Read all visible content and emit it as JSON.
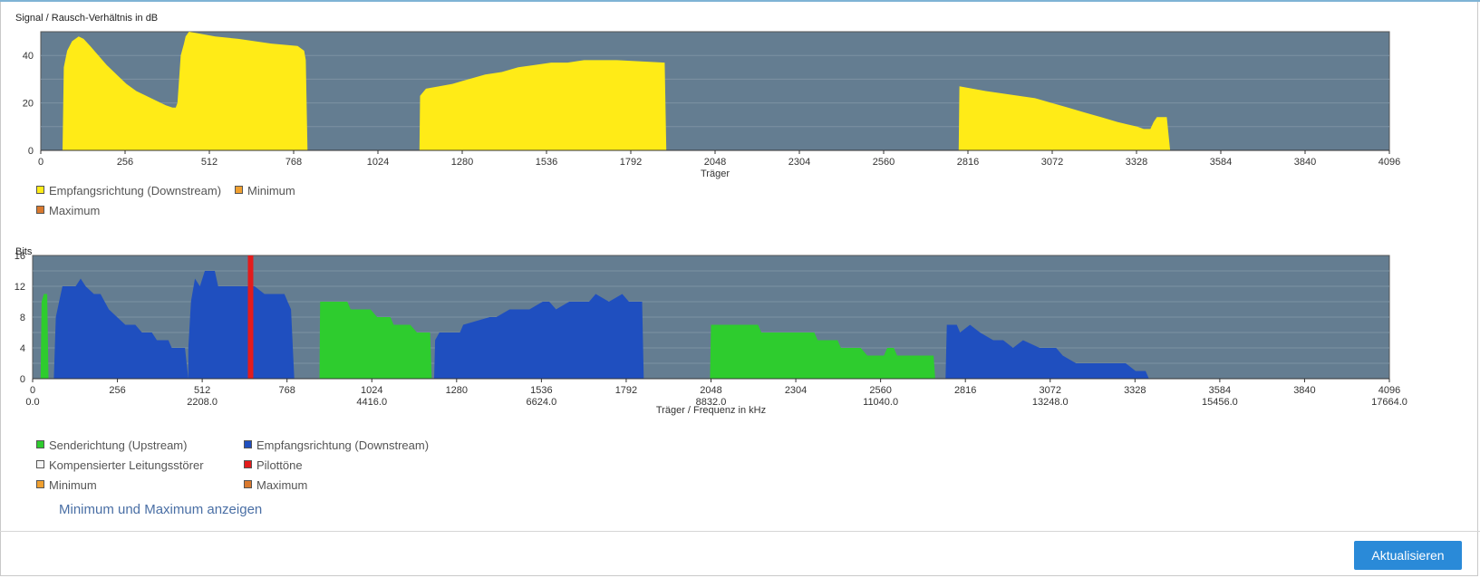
{
  "colors": {
    "plot_bg": "#647d91",
    "grid": "#7d92a3",
    "downstream_snr": "#ffeb17",
    "upstream": "#2ecc2e",
    "downstream_bits": "#1f4fbf",
    "pilot": "#e31c1c",
    "minimum": "#f0a030",
    "maximum": "#d9792e",
    "button": "#2a8ad8"
  },
  "charts": {
    "snr": {
      "title": "Signal / Rausch-Verhältnis in dB",
      "xlabel": "Träger",
      "legend": [
        {
          "label": "Empfangsrichtung (Downstream)",
          "color": "#ffeb17"
        },
        {
          "label": "Minimum",
          "color": "#f0a030"
        },
        {
          "label": "Maximum",
          "color": "#d9792e"
        }
      ]
    },
    "bits": {
      "title": "Bits",
      "xlabel": "Träger / Frequenz in kHz",
      "legend": [
        {
          "label": "Senderichtung (Upstream)",
          "color": "#2ecc2e"
        },
        {
          "label": "Empfangsrichtung (Downstream)",
          "color": "#1f4fbf"
        },
        {
          "label": "Kompensierter Leitungsstörer",
          "color": "#f5f5f5"
        },
        {
          "label": "Pilottöne",
          "color": "#e31c1c"
        },
        {
          "label": "Minimum",
          "color": "#f0a030"
        },
        {
          "label": "Maximum",
          "color": "#d9792e"
        }
      ]
    }
  },
  "chart_data": [
    {
      "type": "area",
      "title": "Signal / Rausch-Verhältnis in dB",
      "xlabel": "Träger",
      "ylabel": "",
      "xlim": [
        0,
        4096
      ],
      "ylim": [
        0,
        50
      ],
      "xticks": [
        0,
        256,
        512,
        768,
        1024,
        1280,
        1536,
        1792,
        2048,
        2304,
        2560,
        2816,
        3072,
        3328,
        3584,
        3840,
        4096
      ],
      "yticks": [
        0,
        20,
        40
      ],
      "grid": true,
      "legend_position": "bottom",
      "series": [
        {
          "name": "Empfangsrichtung (Downstream)",
          "color": "#ffeb17",
          "segments": [
            [
              [
                66,
                0
              ],
              [
                70,
                35
              ],
              [
                80,
                42
              ],
              [
                95,
                46
              ],
              [
                115,
                48
              ],
              [
                130,
                47
              ],
              [
                150,
                44
              ],
              [
                175,
                40
              ],
              [
                200,
                36
              ],
              [
                230,
                32
              ],
              [
                260,
                28
              ],
              [
                290,
                25
              ],
              [
                320,
                23
              ],
              [
                350,
                21
              ],
              [
                380,
                19
              ],
              [
                400,
                18
              ],
              [
                410,
                18
              ],
              [
                415,
                20
              ],
              [
                425,
                40
              ],
              [
                435,
                45
              ],
              [
                440,
                48
              ],
              [
                450,
                50
              ],
              [
                530,
                48
              ],
              [
                600,
                47
              ],
              [
                700,
                45
              ],
              [
                780,
                44
              ],
              [
                800,
                42
              ],
              [
                805,
                38
              ],
              [
                810,
                0
              ]
            ],
            [
              [
                1150,
                0
              ],
              [
                1152,
                23
              ],
              [
                1170,
                26
              ],
              [
                1210,
                27
              ],
              [
                1250,
                28
              ],
              [
                1300,
                30
              ],
              [
                1350,
                32
              ],
              [
                1400,
                33
              ],
              [
                1450,
                35
              ],
              [
                1500,
                36
              ],
              [
                1550,
                37
              ],
              [
                1600,
                37
              ],
              [
                1650,
                38
              ],
              [
                1700,
                38
              ],
              [
                1750,
                38
              ],
              [
                1895,
                37
              ],
              [
                1900,
                0
              ]
            ],
            [
              [
                2788,
                0
              ],
              [
                2790,
                27
              ],
              [
                2830,
                26
              ],
              [
                2870,
                25
              ],
              [
                2920,
                24
              ],
              [
                2970,
                23
              ],
              [
                3020,
                22
              ],
              [
                3070,
                20
              ],
              [
                3120,
                18
              ],
              [
                3170,
                16
              ],
              [
                3220,
                14
              ],
              [
                3270,
                12
              ],
              [
                3300,
                11
              ],
              [
                3330,
                10
              ],
              [
                3350,
                9
              ],
              [
                3370,
                9
              ],
              [
                3380,
                12
              ],
              [
                3390,
                14
              ],
              [
                3420,
                14
              ],
              [
                3430,
                0
              ]
            ]
          ]
        }
      ]
    },
    {
      "type": "area",
      "title": "Bits",
      "xlabel": "Träger / Frequenz in kHz",
      "ylabel": "",
      "xlim": [
        0,
        4096
      ],
      "ylim": [
        0,
        16
      ],
      "xticks": [
        0,
        256,
        512,
        768,
        1024,
        1280,
        1536,
        1792,
        2048,
        2304,
        2560,
        2816,
        3072,
        3328,
        3584,
        3840,
        4096
      ],
      "freq_ticks": [
        "0.0",
        "2208.0",
        "4416.0",
        "6624.0",
        "8832.0",
        "11040.0",
        "13248.0",
        "15456.0",
        "17664.0"
      ],
      "yticks": [
        0,
        4,
        8,
        12,
        16
      ],
      "grid": true,
      "legend_position": "bottom",
      "series": [
        {
          "name": "Senderichtung (Upstream)",
          "color": "#2ecc2e",
          "segments": [
            [
              [
                24,
                0
              ],
              [
                27,
                10
              ],
              [
                34,
                11
              ],
              [
                44,
                11
              ],
              [
                48,
                0
              ]
            ],
            [
              [
                866,
                0
              ],
              [
                868,
                10
              ],
              [
                950,
                10
              ],
              [
                960,
                9
              ],
              [
                1020,
                9
              ],
              [
                1040,
                8
              ],
              [
                1080,
                8
              ],
              [
                1090,
                7
              ],
              [
                1140,
                7
              ],
              [
                1160,
                6
              ],
              [
                1200,
                6
              ],
              [
                1205,
                0
              ]
            ],
            [
              [
                2045,
                0
              ],
              [
                2048,
                7
              ],
              [
                2190,
                7
              ],
              [
                2200,
                6
              ],
              [
                2360,
                6
              ],
              [
                2370,
                5
              ],
              [
                2430,
                5
              ],
              [
                2440,
                4
              ],
              [
                2500,
                4
              ],
              [
                2520,
                3
              ],
              [
                2570,
                3
              ],
              [
                2580,
                4
              ],
              [
                2600,
                4
              ],
              [
                2610,
                3
              ],
              [
                2720,
                3
              ],
              [
                2725,
                0
              ]
            ]
          ]
        },
        {
          "name": "Empfangsrichtung (Downstream)",
          "color": "#1f4fbf",
          "segments": [
            [
              [
                64,
                0
              ],
              [
                70,
                8
              ],
              [
                80,
                10
              ],
              [
                90,
                12
              ],
              [
                120,
                12
              ],
              [
                130,
                12
              ],
              [
                145,
                13
              ],
              [
                160,
                12
              ],
              [
                185,
                11
              ],
              [
                205,
                11
              ],
              [
                230,
                9
              ],
              [
                255,
                8
              ],
              [
                280,
                7
              ],
              [
                310,
                7
              ],
              [
                330,
                6
              ],
              [
                360,
                6
              ],
              [
                375,
                5
              ],
              [
                410,
                5
              ],
              [
                420,
                4
              ],
              [
                460,
                4
              ],
              [
                470,
                0
              ],
              [
                470,
                4
              ],
              [
                478,
                10
              ],
              [
                490,
                13
              ],
              [
                505,
                12
              ],
              [
                520,
                14
              ],
              [
                550,
                14
              ],
              [
                560,
                12
              ],
              [
                620,
                12
              ],
              [
                650,
                12
              ],
              [
                670,
                12
              ],
              [
                700,
                11
              ],
              [
                760,
                11
              ],
              [
                770,
                10
              ],
              [
                780,
                9
              ],
              [
                790,
                0
              ]
            ],
            [
              [
                1212,
                0
              ],
              [
                1215,
                5
              ],
              [
                1228,
                6
              ],
              [
                1290,
                6
              ],
              [
                1300,
                7
              ],
              [
                1380,
                8
              ],
              [
                1400,
                8
              ],
              [
                1440,
                9
              ],
              [
                1470,
                9
              ],
              [
                1480,
                9
              ],
              [
                1500,
                9
              ],
              [
                1540,
                10
              ],
              [
                1560,
                10
              ],
              [
                1580,
                9
              ],
              [
                1620,
                10
              ],
              [
                1680,
                10
              ],
              [
                1700,
                11
              ],
              [
                1740,
                10
              ],
              [
                1780,
                11
              ],
              [
                1800,
                10
              ],
              [
                1840,
                10
              ],
              [
                1845,
                0
              ]
            ],
            [
              [
                2756,
                0
              ],
              [
                2760,
                7
              ],
              [
                2790,
                7
              ],
              [
                2800,
                6
              ],
              [
                2830,
                7
              ],
              [
                2860,
                6
              ],
              [
                2900,
                5
              ],
              [
                2930,
                5
              ],
              [
                2960,
                4
              ],
              [
                2990,
                5
              ],
              [
                3040,
                4
              ],
              [
                3090,
                4
              ],
              [
                3110,
                3
              ],
              [
                3150,
                2
              ],
              [
                3200,
                2
              ],
              [
                3300,
                2
              ],
              [
                3330,
                1
              ],
              [
                3360,
                1
              ],
              [
                3370,
                0
              ]
            ]
          ]
        },
        {
          "name": "Pilottöne",
          "color": "#e31c1c",
          "pilot_carriers": [
            658
          ]
        }
      ]
    }
  ],
  "actions": {
    "toggle_minmax": "Minimum und Maximum anzeigen",
    "refresh": "Aktualisieren"
  }
}
